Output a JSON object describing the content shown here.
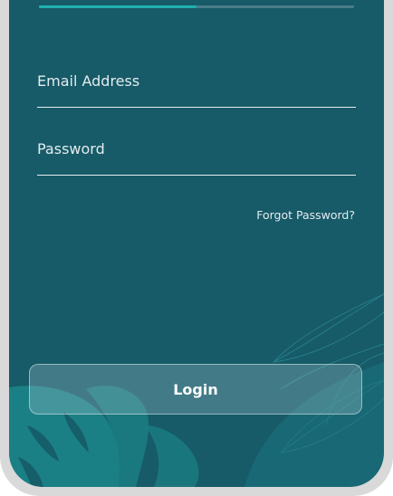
{
  "progress": {
    "value": 0.5,
    "fill_color": "#1fb1ad",
    "track_color": "#4a7d88"
  },
  "form": {
    "email": {
      "placeholder": "Email Address",
      "value": ""
    },
    "password": {
      "placeholder": "Password",
      "value": ""
    },
    "forgot_label": "Forgot Password?",
    "login_label": "Login"
  },
  "theme": {
    "background": "#175a68",
    "leaf_color": "#1d8a8c",
    "frame_color": "#d9d9d9"
  }
}
